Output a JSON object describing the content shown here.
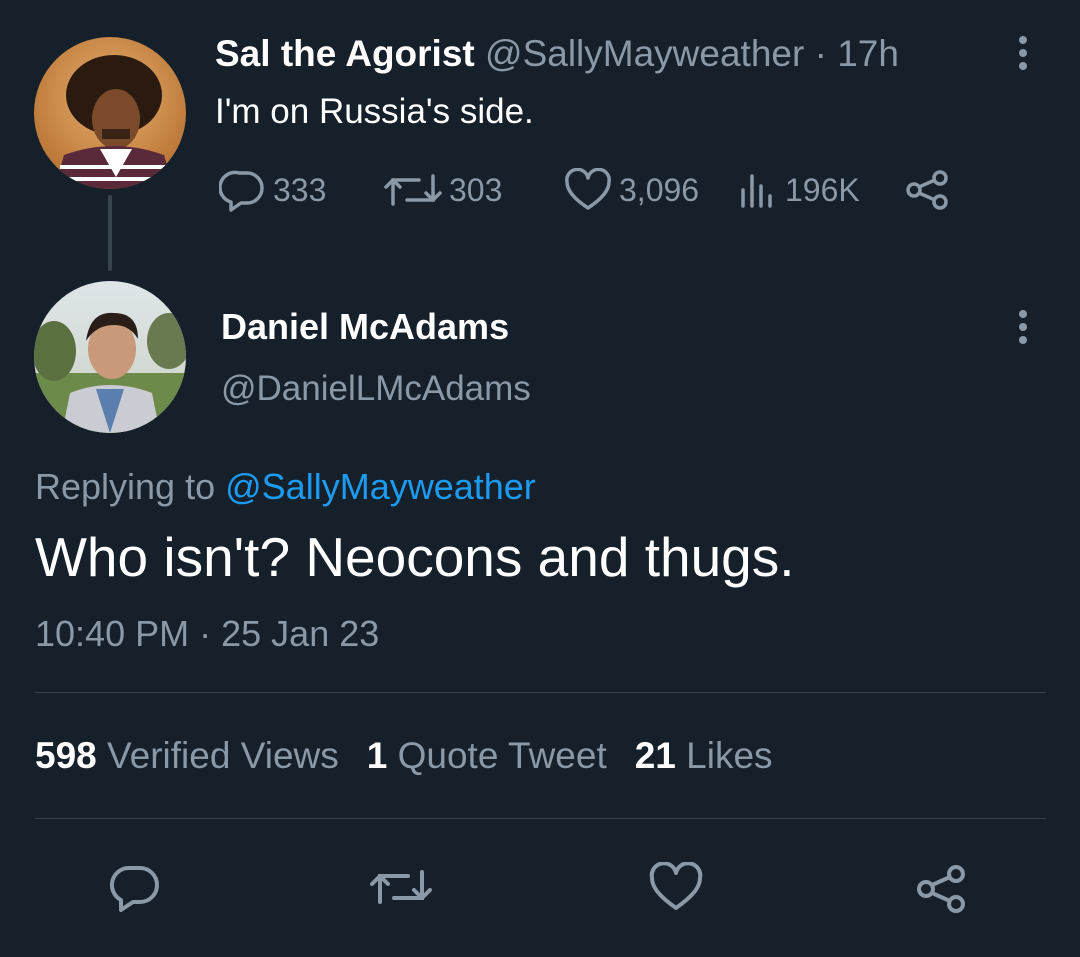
{
  "parent_tweet": {
    "name": "Sal the Agorist",
    "handle": "@SallyMayweather",
    "separator": "·",
    "time": "17h",
    "text": "I'm on Russia's side.",
    "actions": {
      "replies": "333",
      "retweets": "303",
      "likes": "3,096",
      "views": "196K"
    }
  },
  "main_tweet": {
    "name": "Daniel McAdams",
    "handle": "@DanielLMcAdams",
    "replying_prefix": "Replying to",
    "replying_to": "@SallyMayweather",
    "text": "Who isn't? Neocons and thugs.",
    "time": "10:40 PM",
    "separator": "·",
    "date": "25 Jan 23",
    "stats": {
      "views_count": "598",
      "views_label": "Verified Views",
      "quotes_count": "1",
      "quotes_label": "Quote Tweet",
      "likes_count": "21",
      "likes_label": "Likes"
    }
  },
  "colors": {
    "background": "#15202b",
    "primary_text": "#ffffff",
    "secondary_text": "#8b98a5",
    "link": "#1d9bf0",
    "divider": "#38444d"
  },
  "icons": [
    "reply-icon",
    "retweet-icon",
    "like-icon",
    "views-icon",
    "share-icon",
    "more-icon"
  ]
}
